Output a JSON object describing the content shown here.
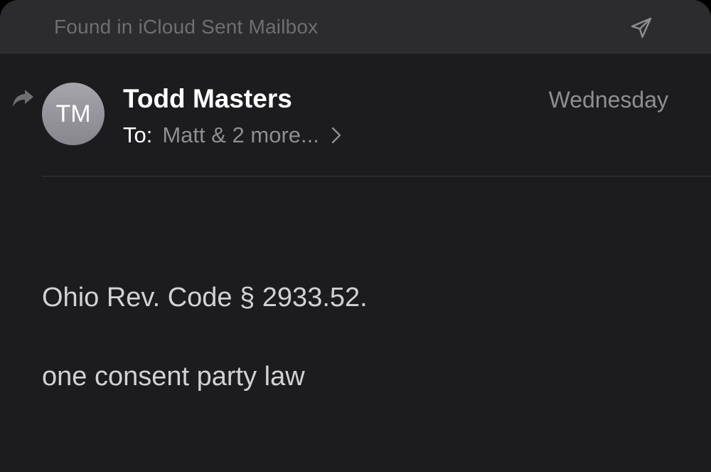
{
  "banner": {
    "text": "Found in iCloud Sent Mailbox",
    "action_icon": "paper-plane-icon"
  },
  "message": {
    "status_icon": "replied-arrow-icon",
    "avatar_initials": "TM",
    "sender": "Todd Masters",
    "date": "Wednesday",
    "to_label": "To:",
    "recipients": "Matt & 2 more...",
    "recipients_icon": "chevron-right-icon",
    "body": {
      "line1": "Ohio Rev. Code § 2933.52.",
      "line2": "one consent party law"
    }
  },
  "colors": {
    "background": "#1c1c1e",
    "banner_background": "#2c2c2e",
    "primary_text": "#ffffff",
    "secondary_text": "#8e8e93",
    "body_text": "#d1d1d6"
  }
}
